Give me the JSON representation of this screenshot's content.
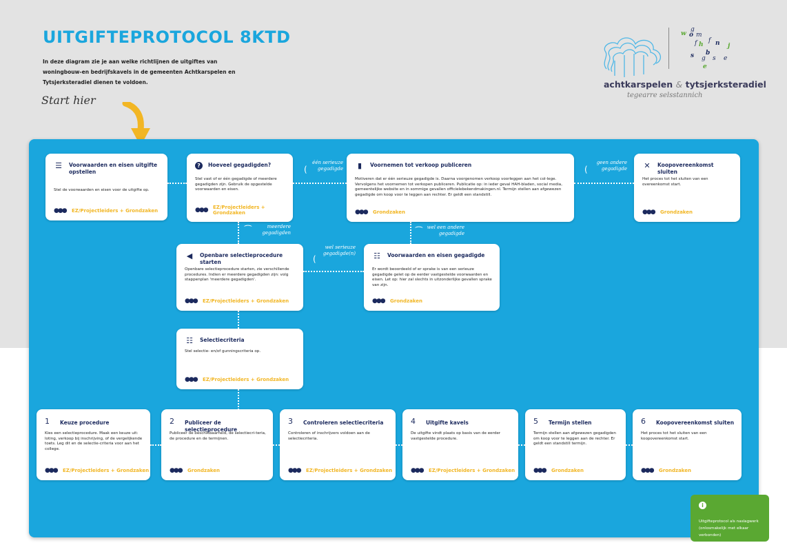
{
  "header": {
    "title": "UITGIFTEPROTOCOL 8KTD",
    "intro": "In deze diagram zie je aan welke richtlijnen de uitgiftes van woningbouw-en bedrijfskavels in de gemeenten Achtkarspelen en Tytsjerksteradiel dienen te voldoen.",
    "start_label": "Start hier"
  },
  "logo": {
    "org_left": "achtkarspelen",
    "amp": "&",
    "org_right": "tytsjerksteradiel",
    "tagline": "tegearre selsstannich",
    "letters": [
      "w",
      "g",
      "o",
      "m",
      "f",
      "h",
      "f",
      "n",
      "j",
      "s",
      "b",
      "g",
      "s",
      "e",
      "e"
    ]
  },
  "cards": {
    "c1": {
      "title": "Voorwaarden en eisen uitgifte opstellen",
      "body": "Stel de voorwaarden en eisen voor de uitgifte op.",
      "owner": "EZ/Projectleiders + Grondzaken",
      "icon": "list-icon"
    },
    "c2": {
      "title": "Hoeveel gegadigden?",
      "body": "Stel vast of er één gegadigde of meerdere gegadigden zijn. Gebruik de opgestelde voorwaarden en eisen.",
      "owner": "EZ/Projectleiders + Grondzaken",
      "icon": "question-icon"
    },
    "c3": {
      "title": "Voornemen tot verkoop publiceren",
      "body": "Motiveren dat er één serieuze gegadigde is. Daarna voorgenomen verkoop voorleggen aan het col-lege. Vervolgens het voornemen tot verkopen publiceren. Publicatie op: in ieder geval HAH-bladen, social media, gemeentelijke website en in sommige gevallen officielebekendmakingen.nl. Termijn stellen aan afgewezen gegadigde om koop voor te leggen aan rechter. Er geldt een standstill.",
      "owner": "Grondzaken",
      "icon": "document-icon"
    },
    "c4": {
      "title": "Koopovereenkomst sluiten",
      "body": "Het proces tot het sluiten van een overeenkomst start.",
      "owner": "Grondzaken",
      "icon": "close-icon"
    },
    "c5": {
      "title": "Openbare selectieprocedure starten",
      "body": "Openbare selectieprocedure starten, zie verschillende procedures. Indien er meerdere gegadigden zijn: volg stappenplan 'meerdere gegadigden'.",
      "owner": "EZ/Projectleiders + Grondzaken",
      "icon": "megaphone-icon"
    },
    "c6": {
      "title": "Voorwaarden en eisen gegadigde",
      "body": "Er wordt beoordeeld of er sprake is van een serieuze gegadigde gelet op de eerder vastgestelde voorwaarden en eisen. Let op: hier zal slechts in uitzonderlijke gevallen sprake van zijn.",
      "owner": "Grondzaken",
      "icon": "checklist-icon"
    },
    "c7": {
      "title": "Selectiecriteria",
      "body": "Stel selectie- en/of gunningscriteria op.",
      "owner": "EZ/Projectleiders + Grondzaken",
      "icon": "checklist-icon"
    }
  },
  "steps": [
    {
      "num": "1",
      "title": "Keuze procedure",
      "body": "Kies een selectieprocedure. Maak een keuze uit: loting, verkoop bij inschrijving, of de vergelijkende toets. Leg dit en de selectie-criteria voor aan het college.",
      "owner": "EZ/Projectleiders + Grondzaken"
    },
    {
      "num": "2",
      "title": "Publiceer de selectieprocedure",
      "body": "Publiceer de beschikbaarheid, de selectiecri-teria, de procedure en de termijnen.",
      "owner": "Grondzaken"
    },
    {
      "num": "3",
      "title": "Controleren selectiecriteria",
      "body": "Controleren of inschrijvers voldoen aan de selectiecriteria.",
      "owner": "EZ/Projectleiders + Grondzaken"
    },
    {
      "num": "4",
      "title": "Uitgifte kavels",
      "body": "De uitgifte vindt plaats op basis van de eerder vastgestelde procedure.",
      "owner": "EZ/Projectleiders + Grondzaken"
    },
    {
      "num": "5",
      "title": "Termijn stellen",
      "body": "Termijn stellen aan afgewezen gegadigden om koop voor te leggen aan de rechter. Er geldt een standstill termijn.",
      "owner": "Grondzaken"
    },
    {
      "num": "6",
      "title": "Koopovereenkomst sluiten",
      "body": "Het proces tot het sluiten van een koopovereenkomst start.",
      "owner": "Grondzaken"
    }
  ],
  "connectors": {
    "een_serieuze": "één serieuze gegadigde",
    "geen_andere": "geen andere gegadigde",
    "meerdere": "meerdere gegadigden",
    "wel_een_andere": "wel een andere gegadigde",
    "wel_serieuze": "wel serieuze gegadigde(n)"
  },
  "info": {
    "text": "Uitgifteprotocol als naslagwerk (onlosmakelijk met elkaar verbonden)"
  },
  "colors": {
    "panel": "#1aa6dd",
    "title": "#1aa6dd",
    "navy": "#1c2a5e",
    "owner": "#f2b624",
    "info": "#5aa832",
    "arrow": "#f2b624"
  }
}
